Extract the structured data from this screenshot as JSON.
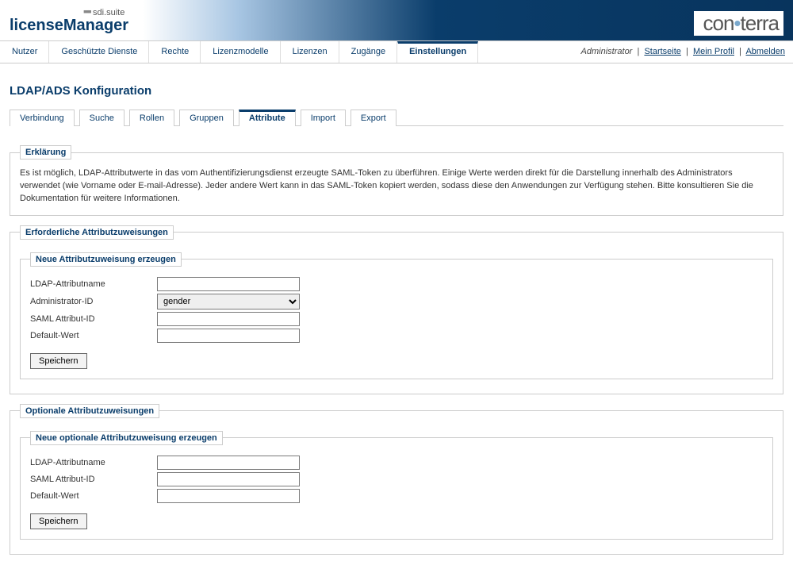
{
  "header": {
    "suite": "sdi.suite",
    "appTitle": "licenseManager",
    "brandA": "con",
    "brandB": "terra"
  },
  "topnav": {
    "tabs": [
      {
        "label": "Nutzer"
      },
      {
        "label": "Geschützte Dienste"
      },
      {
        "label": "Rechte"
      },
      {
        "label": "Lizenzmodelle"
      },
      {
        "label": "Lizenzen"
      },
      {
        "label": "Zugänge"
      },
      {
        "label": "Einstellungen"
      }
    ],
    "user": "Administrator",
    "links": {
      "home": "Startseite",
      "profile": "Mein Profil",
      "logout": "Abmelden"
    }
  },
  "pageTitle": "LDAP/ADS Konfiguration",
  "subtabs": [
    "Verbindung",
    "Suche",
    "Rollen",
    "Gruppen",
    "Attribute",
    "Import",
    "Export"
  ],
  "explain": {
    "legend": "Erklärung",
    "text": "Es ist möglich, LDAP-Attributwerte in das vom Authentifizierungsdienst erzeugte SAML-Token zu überführen. Einige Werte werden direkt für die Darstellung innerhalb des Administrators verwendet (wie Vorname oder E-mail-Adresse). Jeder andere Wert kann in das SAML-Token kopiert werden, sodass diese den Anwendungen zur Verfügung stehen. Bitte konsultieren Sie die Dokumentation für weitere Informationen."
  },
  "required": {
    "legend": "Erforderliche Attributzuweisungen",
    "innerLegend": "Neue Attributzuweisung erzeugen",
    "fields": {
      "ldap": "LDAP-Attributname",
      "admin": "Administrator-ID",
      "saml": "SAML Attribut-ID",
      "default": "Default-Wert"
    },
    "adminSelected": "gender",
    "save": "Speichern"
  },
  "optional": {
    "legend": "Optionale Attributzuweisungen",
    "innerLegend": "Neue optionale Attributzuweisung erzeugen",
    "fields": {
      "ldap": "LDAP-Attributname",
      "saml": "SAML Attribut-ID",
      "default": "Default-Wert"
    },
    "save": "Speichern"
  }
}
